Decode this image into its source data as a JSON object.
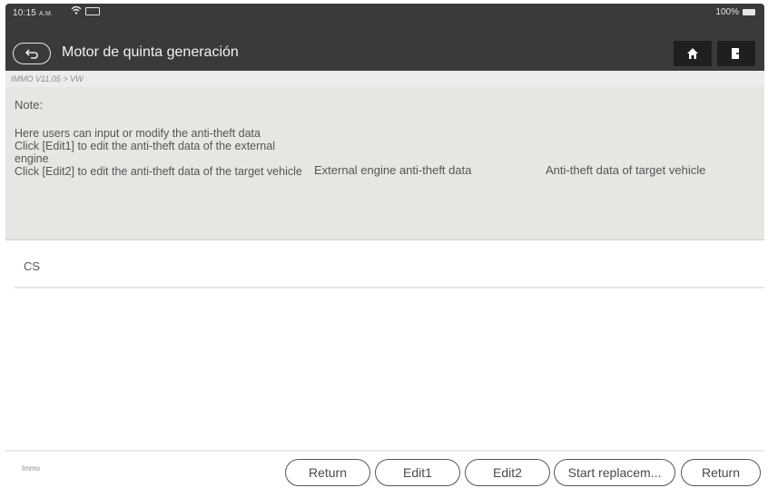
{
  "status": {
    "time": "10:15",
    "ampm": "A.M.",
    "battery": "100%"
  },
  "icons": {
    "back": "back-arrow-icon",
    "home": "home-icon",
    "exit": "exit-icon",
    "wifi": "wifi-icon",
    "battery": "battery-icon"
  },
  "header": {
    "title": "Motor de quinta generación"
  },
  "breadcrumb": "IMMO V11.05 > VW",
  "table": {
    "note_label": "Note:",
    "note_text": "Here users can input or modify the anti-theft data\nClick [Edit1] to edit the anti-theft data of the external engine\nClick [Edit2] to edit the anti-theft data of the target vehicle",
    "columns": [
      "External engine anti-theft data",
      "Anti-theft data of target vehicle"
    ],
    "rows": [
      {
        "label": "CS",
        "external": "",
        "target": ""
      }
    ]
  },
  "footer": {
    "label": "Immo",
    "buttons": [
      "Return",
      "Edit1",
      "Edit2",
      "Start replacem...",
      "Return"
    ]
  }
}
